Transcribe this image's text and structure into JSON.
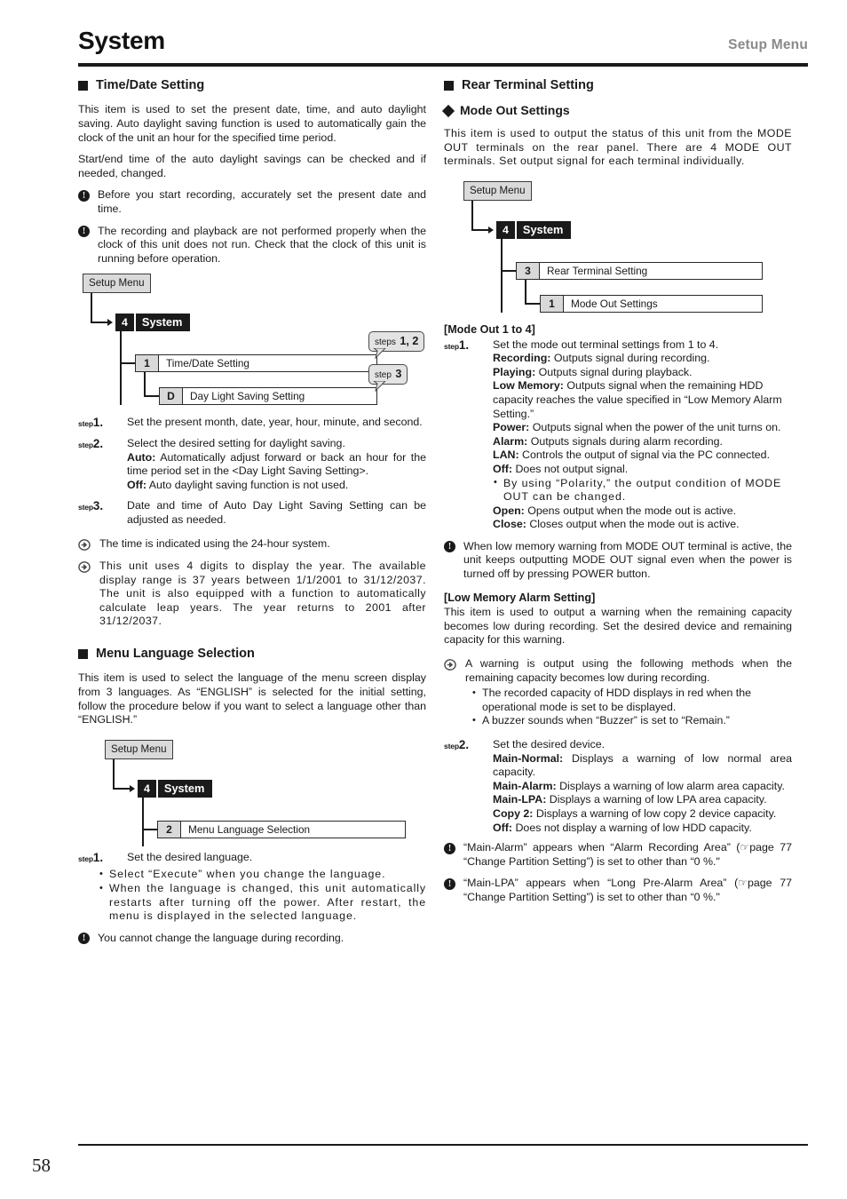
{
  "header": {
    "title": "System",
    "right_label": "Setup Menu"
  },
  "folio": "58",
  "left": {
    "section1": {
      "heading": "Time/Date Setting",
      "intro1": "This item is used to set the present date, time, and auto daylight saving. Auto daylight saving function is used to automatically gain the clock of the unit an hour for the specified time period.",
      "intro2": "Start/end time of the auto daylight savings can be checked and if needed, changed.",
      "note1": "Before you start recording, accurately set the present date and time.",
      "note2": "The recording and playback are not performed properly when the clock of this unit does not run. Check that the clock of this unit is running before operation.",
      "diagram": {
        "setup_menu": "Setup Menu",
        "sys_num": "4",
        "sys_name": "System",
        "item1_key": "1",
        "item1_label": "Time/Date Setting",
        "item2_key": "D",
        "item2_label": "Day Light Saving Setting",
        "callout1_word": "steps",
        "callout1_num": "1, 2",
        "callout2_word": "step",
        "callout2_num": "3"
      },
      "step1": {
        "word": "step",
        "num": "1.",
        "text": "Set the present month, date, year, hour, minute, and second."
      },
      "step2": {
        "word": "step",
        "num": "2.",
        "line1": "Select the desired setting for daylight saving.",
        "auto_label": "Auto:",
        "auto_text": "Automatically adjust forward or back an hour for the time period set in the <Day Light Saving Setting>.",
        "off_label": "Off:",
        "off_text": "Auto daylight saving function is not used."
      },
      "step3": {
        "word": "step",
        "num": "3.",
        "text": "Date and time of Auto Day Light Saving Setting can be adjusted as needed."
      },
      "memo1": "The time is indicated using the 24-hour system.",
      "memo2": "This unit uses 4 digits to display the year. The available display range is 37 years between 1/1/2001 to 31/12/2037. The unit is also equipped with a function to automatically calculate leap years. The year returns to 2001 after 31/12/2037."
    },
    "section2": {
      "heading": "Menu Language Selection",
      "intro": "This item is used to select the language of the menu screen display from 3 languages. As “ENGLISH” is selected for the initial setting, follow the procedure below if you want to select a language other than “ENGLISH.”",
      "diagram": {
        "setup_menu": "Setup Menu",
        "sys_num": "4",
        "sys_name": "System",
        "item1_key": "2",
        "item1_label": "Menu Language Selection"
      },
      "step1": {
        "word": "step",
        "num": "1.",
        "line1": "Set the desired language.",
        "bullet1": "Select “Execute” when you change the language.",
        "bullet2": "When the language is changed, this unit automatically restarts after turning off the power. After restart, the menu is displayed in the selected language."
      },
      "note1": "You cannot change the language during recording."
    }
  },
  "right": {
    "section1": {
      "heading": "Rear Terminal Setting",
      "subheading": "Mode Out Settings",
      "intro": "This item is used to output the status of this unit from the MODE OUT terminals on the rear panel. There are 4 MODE OUT terminals. Set output signal for each terminal individually.",
      "diagram": {
        "setup_menu": "Setup Menu",
        "sys_num": "4",
        "sys_name": "System",
        "item1_key": "3",
        "item1_label": "Rear Terminal Setting",
        "item2_key": "1",
        "item2_label": "Mode Out Settings"
      },
      "mode_out_head": "[Mode Out 1 to 4]",
      "step1": {
        "word": "step",
        "num": "1.",
        "line1": "Set the mode out terminal settings from 1 to 4.",
        "options": [
          {
            "label": "Recording:",
            "text": "Outputs signal during recording."
          },
          {
            "label": "Playing:",
            "text": "Outputs signal during playback."
          },
          {
            "label": "Low Memory:",
            "text": "Outputs signal when the remaining HDD capacity reaches the value specified in “Low Memory Alarm Setting.”"
          },
          {
            "label": "Power:",
            "text": "Outputs signal when the power of the unit turns on."
          },
          {
            "label": "Alarm:",
            "text": "Outputs signals during alarm recording."
          },
          {
            "label": "LAN:",
            "text": "Controls the output of signal via the PC connected."
          },
          {
            "label": "Off:",
            "text": "Does not output signal."
          }
        ],
        "bullet": "By using “Polarity,” the output condition of MODE OUT can be changed.",
        "options2": [
          {
            "label": "Open:",
            "text": "Opens output when the mode out is active."
          },
          {
            "label": "Close:",
            "text": "Closes output when the mode out is active."
          }
        ]
      },
      "note1": "When low memory warning from MODE OUT terminal is active, the unit keeps outputting MODE OUT signal even when the power is turned off by pressing POWER button.",
      "low_mem_head": "[Low Memory Alarm Setting]",
      "low_mem_intro": "This item is used to output a warning when the remaining capacity becomes low during recording. Set the desired device and remaining capacity for this warning.",
      "memo1": "A warning is output using the following methods when the remaining capacity becomes low during recording.",
      "memo1_bullets": [
        "The recorded capacity of HDD displays in red when the operational mode is set to be displayed.",
        "A buzzer sounds when “Buzzer” is set to “Remain.”"
      ],
      "step2": {
        "word": "step",
        "num": "2.",
        "line1": "Set the desired device.",
        "options": [
          {
            "label": "Main-Normal:",
            "text": "Displays a warning of low normal area capacity."
          },
          {
            "label": "Main-Alarm:",
            "text": "Displays a warning of low alarm area capacity."
          },
          {
            "label": "Main-LPA:",
            "text": "Displays a warning of low LPA area capacity."
          },
          {
            "label": "Copy 2:",
            "text": "Displays a warning of low copy 2 device capacity."
          },
          {
            "label": "Off:",
            "text": "Does not display a warning of low HDD capacity."
          }
        ]
      },
      "note2_a": "“Main-Alarm” appears when “Alarm Recording Area” (",
      "note2_b": "page 77 “Change Partition Setting”) is set to other than “0 %.\"",
      "note3_a": "“Main-LPA” appears when “Long Pre-Alarm Area” (",
      "note3_b": "page 77 “Change Partition Setting”) is set to other than “0 %.\"",
      "ref_icon": "☞"
    }
  }
}
